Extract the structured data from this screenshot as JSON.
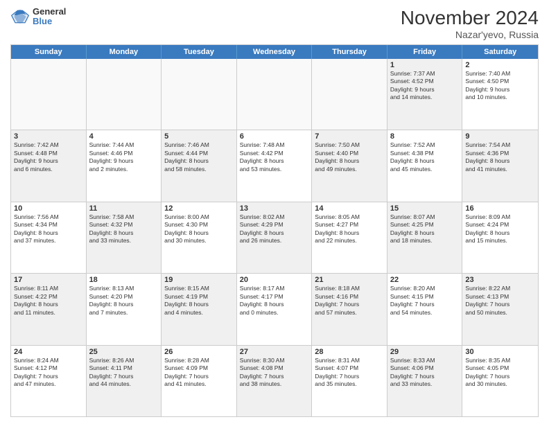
{
  "header": {
    "logo": {
      "general": "General",
      "blue": "Blue"
    },
    "title": "November 2024",
    "location": "Nazar'yevo, Russia"
  },
  "weekdays": [
    "Sunday",
    "Monday",
    "Tuesday",
    "Wednesday",
    "Thursday",
    "Friday",
    "Saturday"
  ],
  "rows": [
    [
      {
        "day": "",
        "info": "",
        "empty": true
      },
      {
        "day": "",
        "info": "",
        "empty": true
      },
      {
        "day": "",
        "info": "",
        "empty": true
      },
      {
        "day": "",
        "info": "",
        "empty": true
      },
      {
        "day": "",
        "info": "",
        "empty": true
      },
      {
        "day": "1",
        "info": "Sunrise: 7:37 AM\nSunset: 4:52 PM\nDaylight: 9 hours\nand 14 minutes.",
        "shaded": true
      },
      {
        "day": "2",
        "info": "Sunrise: 7:40 AM\nSunset: 4:50 PM\nDaylight: 9 hours\nand 10 minutes.",
        "shaded": false
      }
    ],
    [
      {
        "day": "3",
        "info": "Sunrise: 7:42 AM\nSunset: 4:48 PM\nDaylight: 9 hours\nand 6 minutes.",
        "shaded": true
      },
      {
        "day": "4",
        "info": "Sunrise: 7:44 AM\nSunset: 4:46 PM\nDaylight: 9 hours\nand 2 minutes.",
        "shaded": false
      },
      {
        "day": "5",
        "info": "Sunrise: 7:46 AM\nSunset: 4:44 PM\nDaylight: 8 hours\nand 58 minutes.",
        "shaded": true
      },
      {
        "day": "6",
        "info": "Sunrise: 7:48 AM\nSunset: 4:42 PM\nDaylight: 8 hours\nand 53 minutes.",
        "shaded": false
      },
      {
        "day": "7",
        "info": "Sunrise: 7:50 AM\nSunset: 4:40 PM\nDaylight: 8 hours\nand 49 minutes.",
        "shaded": true
      },
      {
        "day": "8",
        "info": "Sunrise: 7:52 AM\nSunset: 4:38 PM\nDaylight: 8 hours\nand 45 minutes.",
        "shaded": false
      },
      {
        "day": "9",
        "info": "Sunrise: 7:54 AM\nSunset: 4:36 PM\nDaylight: 8 hours\nand 41 minutes.",
        "shaded": true
      }
    ],
    [
      {
        "day": "10",
        "info": "Sunrise: 7:56 AM\nSunset: 4:34 PM\nDaylight: 8 hours\nand 37 minutes.",
        "shaded": false
      },
      {
        "day": "11",
        "info": "Sunrise: 7:58 AM\nSunset: 4:32 PM\nDaylight: 8 hours\nand 33 minutes.",
        "shaded": true
      },
      {
        "day": "12",
        "info": "Sunrise: 8:00 AM\nSunset: 4:30 PM\nDaylight: 8 hours\nand 30 minutes.",
        "shaded": false
      },
      {
        "day": "13",
        "info": "Sunrise: 8:02 AM\nSunset: 4:29 PM\nDaylight: 8 hours\nand 26 minutes.",
        "shaded": true
      },
      {
        "day": "14",
        "info": "Sunrise: 8:05 AM\nSunset: 4:27 PM\nDaylight: 8 hours\nand 22 minutes.",
        "shaded": false
      },
      {
        "day": "15",
        "info": "Sunrise: 8:07 AM\nSunset: 4:25 PM\nDaylight: 8 hours\nand 18 minutes.",
        "shaded": true
      },
      {
        "day": "16",
        "info": "Sunrise: 8:09 AM\nSunset: 4:24 PM\nDaylight: 8 hours\nand 15 minutes.",
        "shaded": false
      }
    ],
    [
      {
        "day": "17",
        "info": "Sunrise: 8:11 AM\nSunset: 4:22 PM\nDaylight: 8 hours\nand 11 minutes.",
        "shaded": true
      },
      {
        "day": "18",
        "info": "Sunrise: 8:13 AM\nSunset: 4:20 PM\nDaylight: 8 hours\nand 7 minutes.",
        "shaded": false
      },
      {
        "day": "19",
        "info": "Sunrise: 8:15 AM\nSunset: 4:19 PM\nDaylight: 8 hours\nand 4 minutes.",
        "shaded": true
      },
      {
        "day": "20",
        "info": "Sunrise: 8:17 AM\nSunset: 4:17 PM\nDaylight: 8 hours\nand 0 minutes.",
        "shaded": false
      },
      {
        "day": "21",
        "info": "Sunrise: 8:18 AM\nSunset: 4:16 PM\nDaylight: 7 hours\nand 57 minutes.",
        "shaded": true
      },
      {
        "day": "22",
        "info": "Sunrise: 8:20 AM\nSunset: 4:15 PM\nDaylight: 7 hours\nand 54 minutes.",
        "shaded": false
      },
      {
        "day": "23",
        "info": "Sunrise: 8:22 AM\nSunset: 4:13 PM\nDaylight: 7 hours\nand 50 minutes.",
        "shaded": true
      }
    ],
    [
      {
        "day": "24",
        "info": "Sunrise: 8:24 AM\nSunset: 4:12 PM\nDaylight: 7 hours\nand 47 minutes.",
        "shaded": false
      },
      {
        "day": "25",
        "info": "Sunrise: 8:26 AM\nSunset: 4:11 PM\nDaylight: 7 hours\nand 44 minutes.",
        "shaded": true
      },
      {
        "day": "26",
        "info": "Sunrise: 8:28 AM\nSunset: 4:09 PM\nDaylight: 7 hours\nand 41 minutes.",
        "shaded": false
      },
      {
        "day": "27",
        "info": "Sunrise: 8:30 AM\nSunset: 4:08 PM\nDaylight: 7 hours\nand 38 minutes.",
        "shaded": true
      },
      {
        "day": "28",
        "info": "Sunrise: 8:31 AM\nSunset: 4:07 PM\nDaylight: 7 hours\nand 35 minutes.",
        "shaded": false
      },
      {
        "day": "29",
        "info": "Sunrise: 8:33 AM\nSunset: 4:06 PM\nDaylight: 7 hours\nand 33 minutes.",
        "shaded": true
      },
      {
        "day": "30",
        "info": "Sunrise: 8:35 AM\nSunset: 4:05 PM\nDaylight: 7 hours\nand 30 minutes.",
        "shaded": false
      }
    ]
  ]
}
